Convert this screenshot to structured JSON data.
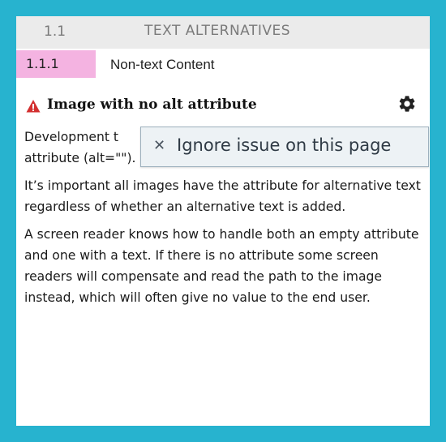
{
  "section": {
    "number": "1.1",
    "title": "TEXT ALTERNATIVES"
  },
  "criterion": {
    "number": "1.1.1",
    "title": "Non-text Content",
    "badge_color": "#f4b3e1"
  },
  "issue": {
    "title": "Image with no alt attribute",
    "severity_icon": "warning-triangle-icon",
    "severity_color": "#d32f2f",
    "settings_icon": "gear-icon",
    "paragraphs": [
      "Development t… attribute (alt=\"\").",
      "It’s important all images have the attribute for alternative text regardless of whether an alternative text is added.",
      "A screen reader knows how to handle both an empty attribute and one with a text. If there is no attribute some screen readers will compensate and read the path to the image instead, which will often give no value to the end user."
    ],
    "paragraph1_visible_start": "Development t",
    "paragraph1_visible_end": "attribute (alt=\"\")."
  },
  "menu": {
    "ignore_label": "Ignore issue on this page",
    "ignore_icon": "close-icon"
  },
  "colors": {
    "frame": "#27b3cf",
    "section_bg": "#ebebeb"
  }
}
